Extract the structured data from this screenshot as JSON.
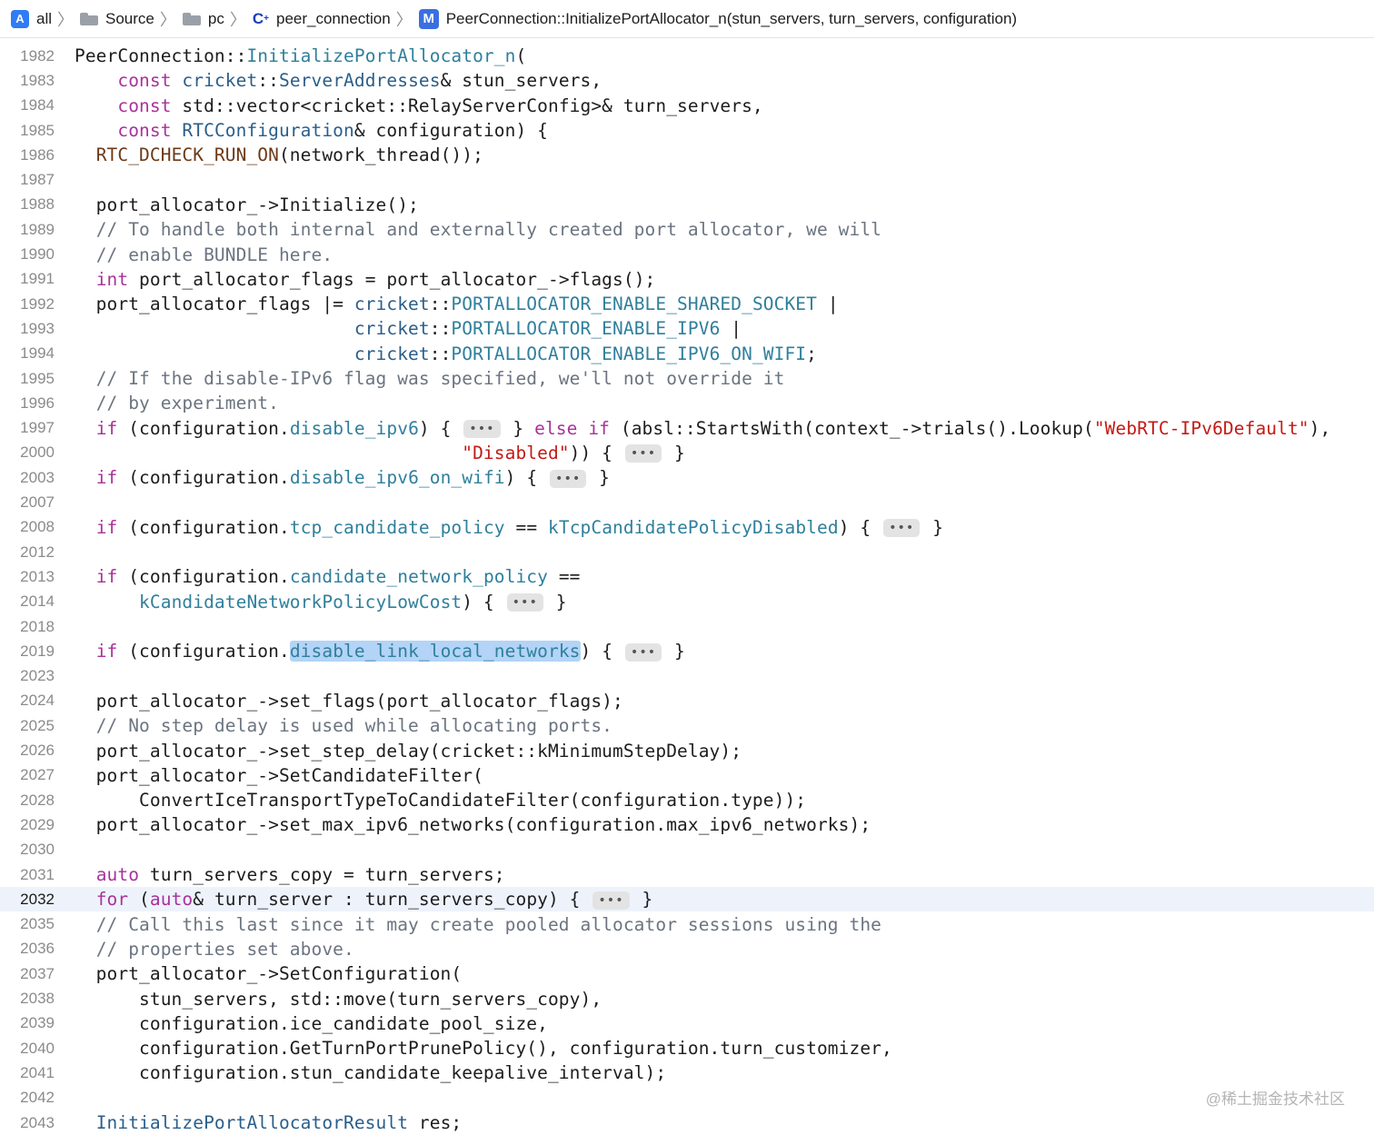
{
  "breadcrumb": {
    "items": [
      {
        "label": "all",
        "icon": "app-icon"
      },
      {
        "label": "Source",
        "icon": "folder-icon"
      },
      {
        "label": "pc",
        "icon": "folder-icon"
      },
      {
        "label": "peer_connection",
        "icon": "cpp-file-icon"
      },
      {
        "label": "PeerConnection::InitializePortAllocator_n(stun_servers, turn_servers, configuration)",
        "icon": "method-icon"
      }
    ],
    "method_icon_letter": "M",
    "cpp_icon_letter": "C"
  },
  "editor": {
    "current_line": "2032",
    "selected_text": "disable_link_local_networks",
    "lines": [
      {
        "n": "1982",
        "text": "PeerConnection::InitializePortAllocator_n("
      },
      {
        "n": "1983",
        "text": "    const cricket::ServerAddresses& stun_servers,"
      },
      {
        "n": "1984",
        "text": "    const std::vector<cricket::RelayServerConfig>& turn_servers,"
      },
      {
        "n": "1985",
        "text": "    const RTCConfiguration& configuration) {"
      },
      {
        "n": "1986",
        "text": "  RTC_DCHECK_RUN_ON(network_thread());"
      },
      {
        "n": "1987",
        "text": ""
      },
      {
        "n": "1988",
        "text": "  port_allocator_->Initialize();"
      },
      {
        "n": "1989",
        "text": "  // To handle both internal and externally created port allocator, we will"
      },
      {
        "n": "1990",
        "text": "  // enable BUNDLE here."
      },
      {
        "n": "1991",
        "text": "  int port_allocator_flags = port_allocator_->flags();"
      },
      {
        "n": "1992",
        "text": "  port_allocator_flags |= cricket::PORTALLOCATOR_ENABLE_SHARED_SOCKET |"
      },
      {
        "n": "1993",
        "text": "                          cricket::PORTALLOCATOR_ENABLE_IPV6 |"
      },
      {
        "n": "1994",
        "text": "                          cricket::PORTALLOCATOR_ENABLE_IPV6_ON_WIFI;"
      },
      {
        "n": "1995",
        "text": "  // If the disable-IPv6 flag was specified, we'll not override it"
      },
      {
        "n": "1996",
        "text": "  // by experiment."
      },
      {
        "n": "1997",
        "text": "  if (configuration.disable_ipv6) { ••• } else if (absl::StartsWith(context_->trials().Lookup(\"WebRTC-IPv6Default\"),"
      },
      {
        "n": "2000",
        "text": "                                    \"Disabled\")) { ••• }"
      },
      {
        "n": "2003",
        "text": "  if (configuration.disable_ipv6_on_wifi) { ••• }"
      },
      {
        "n": "2007",
        "text": ""
      },
      {
        "n": "2008",
        "text": "  if (configuration.tcp_candidate_policy == kTcpCandidatePolicyDisabled) { ••• }"
      },
      {
        "n": "2012",
        "text": ""
      },
      {
        "n": "2013",
        "text": "  if (configuration.candidate_network_policy =="
      },
      {
        "n": "2014",
        "text": "      kCandidateNetworkPolicyLowCost) { ••• }"
      },
      {
        "n": "2018",
        "text": ""
      },
      {
        "n": "2019",
        "text": "  if (configuration.disable_link_local_networks) { ••• }"
      },
      {
        "n": "2023",
        "text": ""
      },
      {
        "n": "2024",
        "text": "  port_allocator_->set_flags(port_allocator_flags);"
      },
      {
        "n": "2025",
        "text": "  // No step delay is used while allocating ports."
      },
      {
        "n": "2026",
        "text": "  port_allocator_->set_step_delay(cricket::kMinimumStepDelay);"
      },
      {
        "n": "2027",
        "text": "  port_allocator_->SetCandidateFilter("
      },
      {
        "n": "2028",
        "text": "      ConvertIceTransportTypeToCandidateFilter(configuration.type));"
      },
      {
        "n": "2029",
        "text": "  port_allocator_->set_max_ipv6_networks(configuration.max_ipv6_networks);"
      },
      {
        "n": "2030",
        "text": ""
      },
      {
        "n": "2031",
        "text": "  auto turn_servers_copy = turn_servers;"
      },
      {
        "n": "2032",
        "text": "  for (auto& turn_server : turn_servers_copy) { ••• }"
      },
      {
        "n": "2035",
        "text": "  // Call this last since it may create pooled allocator sessions using the"
      },
      {
        "n": "2036",
        "text": "  // properties set above."
      },
      {
        "n": "2037",
        "text": "  port_allocator_->SetConfiguration("
      },
      {
        "n": "2038",
        "text": "      stun_servers, std::move(turn_servers_copy),"
      },
      {
        "n": "2039",
        "text": "      configuration.ice_candidate_pool_size,"
      },
      {
        "n": "2040",
        "text": "      configuration.GetTurnPortPrunePolicy(), configuration.turn_customizer,"
      },
      {
        "n": "2041",
        "text": "      configuration.stun_candidate_keepalive_interval);"
      },
      {
        "n": "2042",
        "text": ""
      },
      {
        "n": "2043",
        "text": "  InitializePortAllocatorResult res;"
      }
    ]
  },
  "watermark": "@稀土掘金技术社区",
  "colors": {
    "keyword": "#a8329a",
    "type": "#2b5e8a",
    "member": "#2f7f9c",
    "macro": "#6c3a17",
    "comment": "#6b7480",
    "string": "#c41a16",
    "selection": "#b3d4f6",
    "current_line_bg": "#eef3fb"
  }
}
